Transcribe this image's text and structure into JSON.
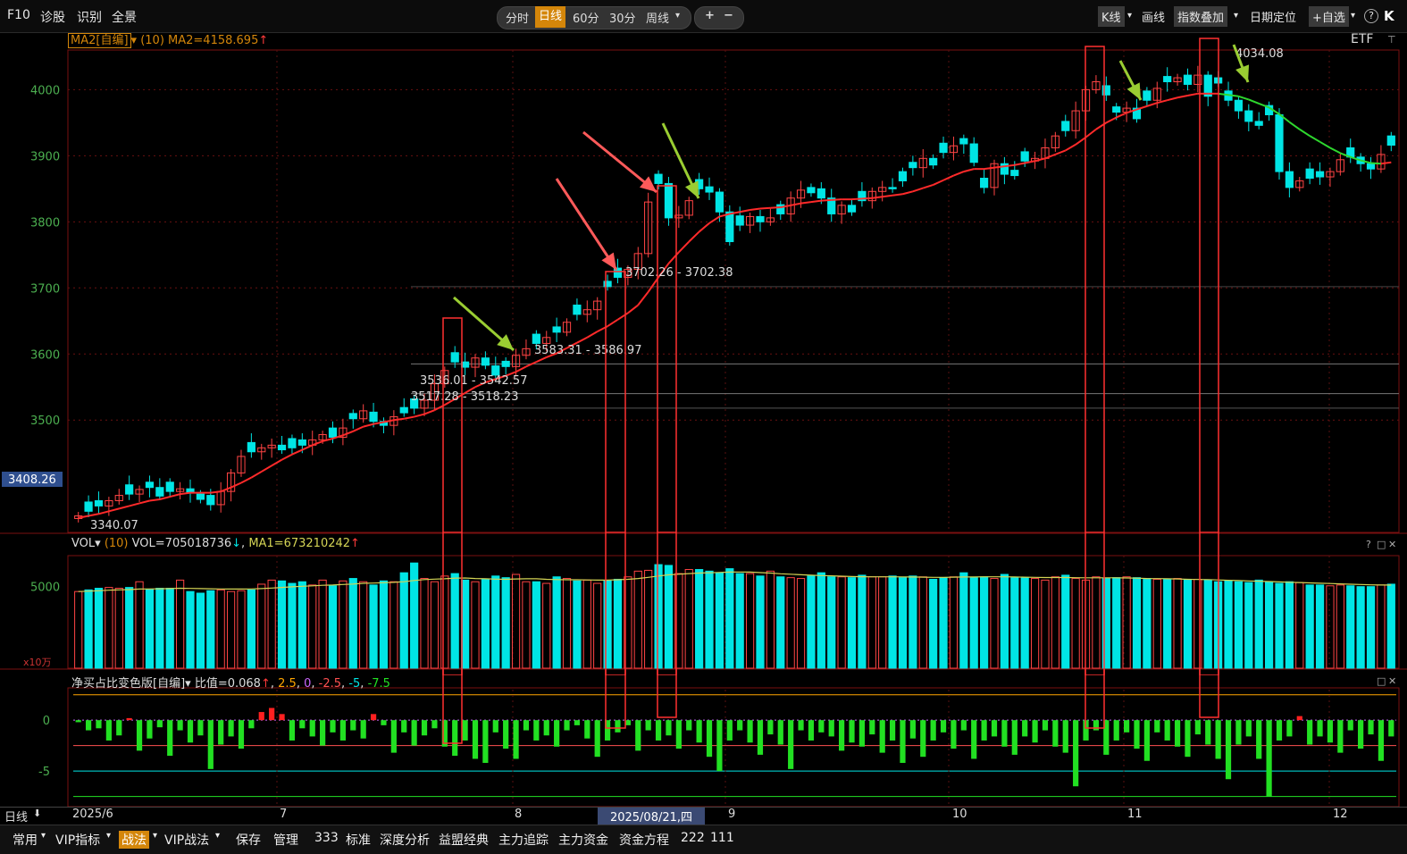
{
  "toolbar": {
    "left": [
      "F10",
      "诊股",
      "识别",
      "全景"
    ],
    "periods": [
      "分时",
      "日线",
      "60分",
      "30分",
      "周线"
    ],
    "active_period": "日线",
    "zoom_in": "+",
    "zoom_out": "−",
    "right": [
      "K线",
      "画线",
      "指数叠加",
      "日期定位",
      "+自选"
    ],
    "help": "?",
    "collapse": "K"
  },
  "price_panel": {
    "indicator_name": "MA2[自编]",
    "indicator_param": "(10)",
    "indicator_value": "MA2=4158.695",
    "instrument": "ETF",
    "current_price": "3408.26",
    "annotations": [
      {
        "text": "3340.07"
      },
      {
        "text": "3517.28 - 3518.23"
      },
      {
        "text": "3536.01 - 3542.57"
      },
      {
        "text": "3583.31 - 3586.97"
      },
      {
        "text": "3702.26 - 3702.38"
      },
      {
        "text": "4034.08"
      }
    ]
  },
  "volume_panel": {
    "name": "VOL",
    "param": "(10)",
    "vol_value": "VOL=705018736",
    "ma_value": "MA1=673210242",
    "unit": "x10万",
    "controls": [
      "?",
      "□",
      "✕"
    ]
  },
  "indicator_panel": {
    "name": "净买占比变色版[自编]",
    "value_label": "比值=0.068",
    "levels": [
      "2.5",
      "0",
      "-2.5",
      "-5",
      "-7.5"
    ],
    "controls": [
      "□",
      "✕"
    ]
  },
  "date_axis": {
    "period_label": "日线",
    "labels": [
      {
        "text": "2025/6"
      },
      {
        "text": "7"
      },
      {
        "text": "8"
      },
      {
        "text": "9"
      },
      {
        "text": "10"
      },
      {
        "text": "11"
      },
      {
        "text": "12"
      }
    ],
    "cursor_date": "2025/08/21,四"
  },
  "bottom_bar": [
    "常用",
    "VIP指标",
    "战法",
    "VIP战法",
    "保存",
    "管理",
    "333",
    "标准",
    "深度分析",
    "益盟经典",
    "主力追踪",
    "主力资金",
    "资金方程",
    "222",
    "111"
  ],
  "bottom_active": "战法",
  "colors": {
    "up": "#ff4444",
    "down": "#00e5e5",
    "ma_up": "#ff2a2a",
    "ma_down": "#2ed82e",
    "axis": "#4caf50",
    "vol_ma": "#d4d455",
    "bar_pos": "#ff2020",
    "bar_neg": "#22e022",
    "box": "#ff3030",
    "arrow_red": "#ff5a5a",
    "arrow_green": "#9acd32"
  },
  "chart_data": {
    "type": "candlestick",
    "x": [
      "2025-06-03",
      "2025-06-04",
      "2025-06-05",
      "2025-06-06",
      "2025-06-09",
      "2025-06-10",
      "2025-06-11",
      "2025-06-12",
      "2025-06-13",
      "2025-06-16",
      "2025-06-17",
      "2025-06-18",
      "2025-06-19",
      "2025-06-20",
      "2025-06-23",
      "2025-06-24",
      "2025-06-25",
      "2025-06-26",
      "2025-06-27",
      "2025-06-30",
      "2025-07-01",
      "2025-07-02",
      "2025-07-03",
      "2025-07-04",
      "2025-07-07",
      "2025-07-08",
      "2025-07-09",
      "2025-07-10",
      "2025-07-11",
      "2025-07-14",
      "2025-07-15",
      "2025-07-16",
      "2025-07-17",
      "2025-07-18",
      "2025-07-21",
      "2025-07-22",
      "2025-07-23",
      "2025-07-24",
      "2025-07-25",
      "2025-07-28",
      "2025-07-29",
      "2025-07-30",
      "2025-07-31",
      "2025-08-01",
      "2025-08-04",
      "2025-08-05",
      "2025-08-06",
      "2025-08-07",
      "2025-08-08",
      "2025-08-11",
      "2025-08-12",
      "2025-08-13",
      "2025-08-14",
      "2025-08-15",
      "2025-08-18",
      "2025-08-19",
      "2025-08-20",
      "2025-08-21",
      "2025-08-22",
      "2025-08-25",
      "2025-08-26",
      "2025-08-27",
      "2025-08-28",
      "2025-08-29",
      "2025-09-01",
      "2025-09-02",
      "2025-09-03",
      "2025-09-04",
      "2025-09-05",
      "2025-09-08",
      "2025-09-09",
      "2025-09-10",
      "2025-09-11",
      "2025-09-12",
      "2025-09-15",
      "2025-09-16",
      "2025-09-17",
      "2025-09-18",
      "2025-09-19",
      "2025-09-22",
      "2025-09-23",
      "2025-09-24",
      "2025-09-25",
      "2025-09-26",
      "2025-09-29",
      "2025-09-30",
      "2025-10-09",
      "2025-10-10",
      "2025-10-13",
      "2025-10-14",
      "2025-10-15",
      "2025-10-16",
      "2025-10-17",
      "2025-10-20",
      "2025-10-21",
      "2025-10-22",
      "2025-10-23",
      "2025-10-24",
      "2025-10-27",
      "2025-10-28",
      "2025-10-29",
      "2025-10-30",
      "2025-10-31",
      "2025-11-03",
      "2025-11-04",
      "2025-11-05",
      "2025-11-06",
      "2025-11-07",
      "2025-11-10",
      "2025-11-11",
      "2025-11-12",
      "2025-11-13",
      "2025-11-14",
      "2025-11-17",
      "2025-11-18",
      "2025-11-19",
      "2025-11-20",
      "2025-11-21",
      "2025-11-24",
      "2025-11-25",
      "2025-11-26",
      "2025-11-27",
      "2025-11-28",
      "2025-12-01",
      "2025-12-02",
      "2025-12-03",
      "2025-12-04",
      "2025-12-05",
      "2025-12-08",
      "2025-12-09"
    ],
    "close": [
      3355,
      3362,
      3370,
      3378,
      3386,
      3388,
      3395,
      3398,
      3385,
      3392,
      3396,
      3390,
      3380,
      3372,
      3392,
      3420,
      3445,
      3452,
      3458,
      3462,
      3455,
      3458,
      3462,
      3470,
      3478,
      3474,
      3488,
      3502,
      3514,
      3498,
      3492,
      3505,
      3511,
      3518,
      3530,
      3555,
      3575,
      3588,
      3580,
      3594,
      3583,
      3568,
      3581,
      3598,
      3608,
      3616,
      3625,
      3633,
      3648,
      3660,
      3667,
      3680,
      3702,
      3716,
      3728,
      3752,
      3830,
      3858,
      3806,
      3810,
      3832,
      3850,
      3845,
      3815,
      3770,
      3795,
      3808,
      3800,
      3806,
      3812,
      3836,
      3848,
      3844,
      3836,
      3812,
      3825,
      3815,
      3832,
      3846,
      3852,
      3850,
      3862,
      3882,
      3896,
      3886,
      3905,
      3915,
      3918,
      3890,
      3852,
      3888,
      3872,
      3870,
      3892,
      3896,
      3912,
      3930,
      3938,
      3968,
      4000,
      4012,
      3992,
      3966,
      3972,
      3956,
      3984,
      4002,
      4012,
      4018,
      4008,
      4022,
      3990,
      4010,
      3984,
      3968,
      3952,
      3946,
      3962,
      3876,
      3852,
      3862,
      3866,
      3868,
      3876,
      3894,
      3898,
      3888,
      3880,
      3902,
      3916
    ],
    "ma": [
      3352,
      3355,
      3358,
      3362,
      3366,
      3370,
      3374,
      3378,
      3380,
      3384,
      3388,
      3390,
      3390,
      3390,
      3392,
      3398,
      3405,
      3413,
      3422,
      3431,
      3440,
      3448,
      3455,
      3462,
      3468,
      3472,
      3477,
      3483,
      3490,
      3494,
      3497,
      3500,
      3502,
      3505,
      3509,
      3515,
      3523,
      3532,
      3541,
      3550,
      3557,
      3562,
      3567,
      3573,
      3581,
      3588,
      3595,
      3601,
      3609,
      3617,
      3625,
      3634,
      3642,
      3652,
      3662,
      3674,
      3694,
      3716,
      3737,
      3754,
      3770,
      3785,
      3798,
      3808,
      3812,
      3815,
      3818,
      3820,
      3821,
      3822,
      3825,
      3828,
      3830,
      3832,
      3833,
      3834,
      3834,
      3835,
      3836,
      3838,
      3840,
      3842,
      3846,
      3851,
      3856,
      3863,
      3870,
      3876,
      3880,
      3880,
      3882,
      3884,
      3886,
      3889,
      3892,
      3896,
      3902,
      3908,
      3917,
      3928,
      3940,
      3950,
      3958,
      3965,
      3970,
      3975,
      3980,
      3984,
      3988,
      3991,
      3994,
      3994,
      3994,
      3992,
      3990,
      3985,
      3979,
      3973,
      3963,
      3951,
      3940,
      3930,
      3921,
      3912,
      3904,
      3898,
      3893,
      3889,
      3888,
      3890
    ],
    "volume": [
      4700,
      4800,
      4900,
      4950,
      4900,
      4950,
      5300,
      4850,
      4900,
      4900,
      5400,
      4700,
      4600,
      4750,
      4800,
      4700,
      4750,
      4800,
      5150,
      5400,
      5350,
      5200,
      5300,
      5100,
      5400,
      5050,
      5350,
      5500,
      5300,
      5100,
      5350,
      5300,
      5850,
      6450,
      5500,
      5300,
      5650,
      5800,
      5400,
      5300,
      5450,
      5650,
      5550,
      5750,
      5300,
      5300,
      5200,
      5600,
      5500,
      5350,
      5400,
      5200,
      5350,
      5450,
      5600,
      5950,
      6000,
      6350,
      6300,
      5800,
      6050,
      6050,
      5950,
      5850,
      6100,
      5800,
      5800,
      5650,
      5950,
      5600,
      5550,
      5500,
      5650,
      5850,
      5600,
      5600,
      5550,
      5700,
      5600,
      5600,
      5650,
      5550,
      5650,
      5600,
      5450,
      5550,
      5600,
      5850,
      5550,
      5600,
      5500,
      5750,
      5550,
      5550,
      5500,
      5400,
      5600,
      5700,
      5500,
      5400,
      5600,
      5500,
      5550,
      5600,
      5550,
      5500,
      5450,
      5450,
      5500,
      5400,
      5450,
      5400,
      5300,
      5350,
      5300,
      5250,
      5400,
      5300,
      5200,
      5300,
      5250,
      5100,
      5100,
      5050,
      5100,
      5050,
      5000,
      5000,
      5100,
      5150
    ],
    "vol_ma": [
      4700,
      4720,
      4750,
      4780,
      4800,
      4820,
      4850,
      4860,
      4870,
      4880,
      4900,
      4890,
      4880,
      4870,
      4860,
      4850,
      4850,
      4860,
      4880,
      4910,
      4950,
      4990,
      5020,
      5050,
      5080,
      5100,
      5130,
      5160,
      5200,
      5220,
      5240,
      5260,
      5300,
      5380,
      5430,
      5460,
      5480,
      5520,
      5530,
      5500,
      5480,
      5460,
      5450,
      5470,
      5480,
      5480,
      5450,
      5430,
      5420,
      5420,
      5410,
      5400,
      5400,
      5420,
      5450,
      5500,
      5570,
      5650,
      5720,
      5760,
      5800,
      5830,
      5850,
      5870,
      5890,
      5900,
      5890,
      5860,
      5830,
      5790,
      5760,
      5730,
      5700,
      5680,
      5660,
      5640,
      5620,
      5610,
      5600,
      5600,
      5600,
      5595,
      5590,
      5580,
      5570,
      5570,
      5580,
      5590,
      5590,
      5600,
      5600,
      5600,
      5590,
      5580,
      5570,
      5560,
      5560,
      5560,
      5550,
      5540,
      5540,
      5540,
      5540,
      5530,
      5520,
      5500,
      5490,
      5480,
      5470,
      5450,
      5440,
      5430,
      5410,
      5390,
      5370,
      5350,
      5330,
      5310,
      5290,
      5270,
      5250,
      5230,
      5210,
      5190,
      5170,
      5150,
      5130,
      5110,
      5100,
      5100
    ],
    "net_ratio": [
      -0.2,
      -1.0,
      -0.8,
      -2.0,
      -1.5,
      0.2,
      -3.0,
      -1.8,
      -0.7,
      -3.5,
      -1.0,
      -2.2,
      -1.5,
      -4.8,
      -2.4,
      -1.6,
      -2.8,
      -0.8,
      0.8,
      1.2,
      0.6,
      -2.0,
      -0.8,
      -1.6,
      -2.5,
      -1.2,
      -2.0,
      -1.0,
      -1.8,
      0.6,
      -0.5,
      -3.2,
      -1.2,
      -2.5,
      -1.5,
      -0.8,
      -2.6,
      -3.5,
      -2.0,
      -3.8,
      -4.2,
      -1.2,
      -2.8,
      -3.8,
      -1.0,
      -2.0,
      -1.5,
      -2.6,
      -1.0,
      -0.5,
      -1.8,
      -3.6,
      -2.0,
      -1.2,
      -0.5,
      -3.0,
      -1.0,
      -2.0,
      -1.5,
      -2.8,
      -1.0,
      -2.2,
      -3.6,
      -5.0,
      -2.0,
      -1.0,
      -2.2,
      -3.4,
      -1.4,
      -2.4,
      -4.8,
      -1.0,
      -2.0,
      -1.2,
      -1.6,
      -3.0,
      -2.2,
      -2.6,
      -1.4,
      -3.2,
      -2.0,
      -4.2,
      -1.8,
      -3.6,
      -2.0,
      -1.2,
      -2.8,
      -1.0,
      -3.8,
      -2.0,
      -1.6,
      -2.6,
      -3.4,
      -1.6,
      -2.2,
      -1.0,
      -2.6,
      -3.2,
      -6.5,
      -2.0,
      -1.0,
      -3.4,
      -2.0,
      -1.2,
      -2.8,
      -4.0,
      -1.2,
      -2.0,
      -2.6,
      -3.6,
      -1.4,
      -2.4,
      -3.8,
      -5.8,
      -2.4,
      -1.6,
      -3.8,
      -7.5,
      -2.0,
      -1.6,
      0.4,
      -2.4,
      -1.6,
      -2.2,
      -3.2,
      -1.0,
      -2.8,
      -1.4,
      -4.0,
      -1.6
    ],
    "yrange_price": [
      3330,
      4060
    ],
    "y_ticks_price": [
      3500,
      3600,
      3700,
      3800,
      3900,
      4000
    ],
    "y_ticks_vol": [
      5000
    ],
    "y_ticks_ind": [
      0,
      -5
    ]
  }
}
